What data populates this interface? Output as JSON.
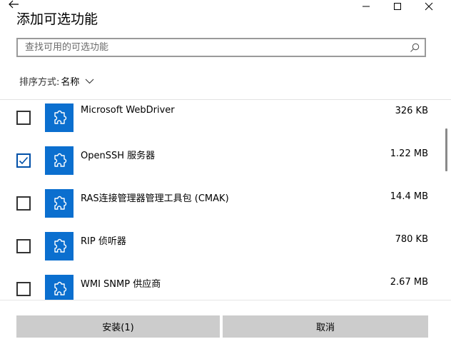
{
  "dialog": {
    "title": "添加可选功能",
    "search_placeholder": "查找可用的可选功能",
    "sort_label": "排序方式:",
    "sort_value": "名称"
  },
  "features": [
    {
      "name": "Microsoft WebDriver",
      "size": "326 KB",
      "checked": false
    },
    {
      "name": "OpenSSH 服务器",
      "size": "1.22 MB",
      "checked": true
    },
    {
      "name": "RAS连接管理器管理工具包 (CMAK)",
      "size": "14.4 MB",
      "checked": false
    },
    {
      "name": "RIP 侦听器",
      "size": "780 KB",
      "checked": false
    },
    {
      "name": "WMI SNMP 供应商",
      "size": "2.67 MB",
      "checked": false
    }
  ],
  "buttons": {
    "install": "安装(1)",
    "cancel": "取消"
  },
  "colors": {
    "accent": "#0b6fcf",
    "button_bg": "#cccccc"
  },
  "icons": {
    "back": "back-arrow-icon",
    "minimize": "minimize-icon",
    "maximize": "maximize-icon",
    "close": "close-icon",
    "search": "search-icon",
    "sort": "chevron-down-icon",
    "feature": "puzzle-piece-icon",
    "checked": "checkmark-icon"
  }
}
